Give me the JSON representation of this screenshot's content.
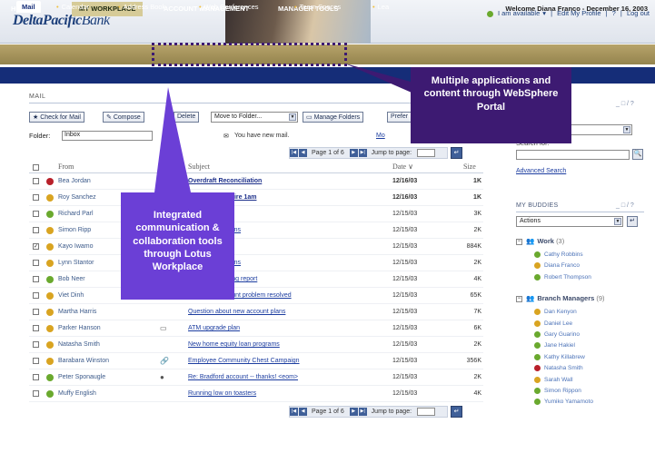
{
  "header": {
    "logo_bold": "DeltaPacific",
    "logo_rest": "Bank",
    "availability": "I am available",
    "edit_profile": "Edit My Profile",
    "help": "?",
    "logout": "Log out"
  },
  "nav": {
    "home": "HOME",
    "workplace": "MY WORKPLACE",
    "account_management": "ACCOUNT MANAGEMENT",
    "manager_tools": "MANAGER TOOLS",
    "welcome": "Welcome Diana Franco - December 16, 2003"
  },
  "subnav": {
    "mail": "Mail",
    "calendar": "Calendar",
    "address_book": "Address Book",
    "web_conferences": "Web Conferences",
    "team_spaces": "Team Spaces",
    "learning": "Lea"
  },
  "mail": {
    "title": "MAIL",
    "check_for_mail": "Check for Mail",
    "compose": "Compose",
    "delete": "Delete",
    "move_to_folder": "Move to Folder...",
    "manage_folders": "Manage Folders",
    "preferences": "Prefer",
    "folder_label": "Folder:",
    "folder_value": "Inbox",
    "new_mail": "You have new mail.",
    "more_link": "Mo",
    "pager_text": "Page 1 of 6",
    "jump_label": "Jump to page:",
    "col_from": "From",
    "col_subject": "Subject",
    "col_date": "Date",
    "col_size": "Size",
    "rows": [
      {
        "from": "Bea Jordan",
        "subject": "Overdraft Reconciliation",
        "date": "12/16/03",
        "size": "1K",
        "status": "#b8202a",
        "checked": "",
        "attach": ""
      },
      {
        "from": "Roy Sanchez",
        "subject": "t mortgage on fire 1am",
        "date": "12/16/03",
        "size": "1K",
        "status": "#d9a421",
        "checked": "",
        "attach": ""
      },
      {
        "from": "Richard Parl",
        "subject": "bors campaign",
        "date": "12/15/03",
        "size": "3K",
        "status": "#6aa92e",
        "checked": "",
        "attach": ""
      },
      {
        "from": "Simon Ripp",
        "subject": "new account plans",
        "date": "12/15/03",
        "size": "2K",
        "status": "#d9a421",
        "checked": "",
        "attach": ""
      },
      {
        "from": "Kayo Iwamo",
        "subject": "plans",
        "date": "12/15/03",
        "size": "884K",
        "status": "#d9a421",
        "checked": "✓",
        "attach": ""
      },
      {
        "from": "Lynn Stantor",
        "subject": "new account plans",
        "date": "12/15/03",
        "size": "2K",
        "status": "#d9a421",
        "checked": "",
        "attach": ""
      },
      {
        "from": "Bob Neer",
        "subject": "Regional planning report",
        "date": "12/15/03",
        "size": "4K",
        "status": "#6aa92e",
        "checked": "",
        "attach": ""
      },
      {
        "from": "Viet Dinh",
        "subject": "Merryman account problem resolved",
        "date": "12/15/03",
        "size": "65K",
        "status": "#d9a421",
        "checked": "",
        "attach": "🔗"
      },
      {
        "from": "Martha Harris",
        "subject": "Question about new account plans",
        "date": "12/15/03",
        "size": "7K",
        "status": "#d9a421",
        "checked": "",
        "attach": ""
      },
      {
        "from": "Parker Hanson",
        "subject": "ATM upgrade plan",
        "date": "12/15/03",
        "size": "6K",
        "status": "#d9a421",
        "checked": "",
        "attach": "▭"
      },
      {
        "from": "Natasha Smith",
        "subject": "New home equity loan programs",
        "date": "12/15/03",
        "size": "2K",
        "status": "#d9a421",
        "checked": "",
        "attach": ""
      },
      {
        "from": "Barabara Winston",
        "subject": "Employee Community Chest Campaign",
        "date": "12/15/03",
        "size": "356K",
        "status": "#d9a421",
        "checked": "",
        "attach": "🔗"
      },
      {
        "from": "Peter Sponaugle",
        "subject": "Re: Bradford account -- thanks! <eom>",
        "date": "12/15/03",
        "size": "2K",
        "status": "#6aa92e",
        "checked": "",
        "attach": "●"
      },
      {
        "from": "Muffy English",
        "subject": "Running low on toasters",
        "date": "12/15/03",
        "size": "4K",
        "status": "#6aa92e",
        "checked": "",
        "attach": ""
      }
    ]
  },
  "right": {
    "search_label": "Search for:",
    "advanced_search": "Advanced Search",
    "buddies_title": "MY BUDDIES",
    "panel_controls": "_ □ / ?",
    "actions": "Actions",
    "groups": [
      {
        "name": "Work",
        "count": "(3)",
        "members": [
          {
            "name": "Cathy Robbins",
            "color": "#6aa92e"
          },
          {
            "name": "Diana Franco",
            "color": "#d9a421"
          },
          {
            "name": "Robert Thompson",
            "color": "#6aa92e"
          }
        ]
      },
      {
        "name": "Branch Managers",
        "count": "(9)",
        "members": [
          {
            "name": "Dan Kenyon",
            "color": "#d9a421"
          },
          {
            "name": "Daniel Lee",
            "color": "#d9a421"
          },
          {
            "name": "Gary Guarino",
            "color": "#6aa92e"
          },
          {
            "name": "Jane Hakiel",
            "color": "#6aa92e"
          },
          {
            "name": "Kathy Killabrew",
            "color": "#6aa92e"
          },
          {
            "name": "Natasha Smith",
            "color": "#b8202a"
          },
          {
            "name": "Sarah Wall",
            "color": "#d9a421"
          },
          {
            "name": "Simon Rippon",
            "color": "#6aa92e"
          },
          {
            "name": "Yumiko Yamamoto",
            "color": "#6aa92e"
          }
        ]
      }
    ]
  },
  "callouts": {
    "portal": "Multiple applications and content through WebSphere Portal",
    "workplace": "Integrated communication & collaboration tools through Lotus Workplace",
    "purple": "#3d1a72",
    "violet": "#6b3fd6"
  }
}
